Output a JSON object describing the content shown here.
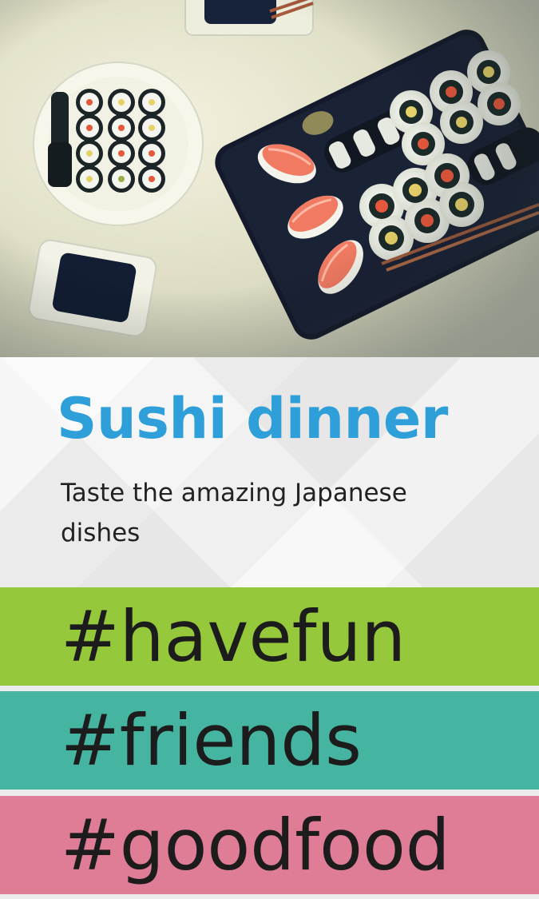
{
  "hero": {
    "image_description_icon": "sushi-photo"
  },
  "card": {
    "title": "Sushi dinner",
    "subtitle": "Taste the amazing Japanese dishes",
    "title_color": "#2f9fd9"
  },
  "hashtags": [
    {
      "label": "#havefun",
      "color": "#95c83b"
    },
    {
      "label": "#friends",
      "color": "#45b4a0"
    },
    {
      "label": "#goodfood",
      "color": "#df7c96"
    }
  ]
}
